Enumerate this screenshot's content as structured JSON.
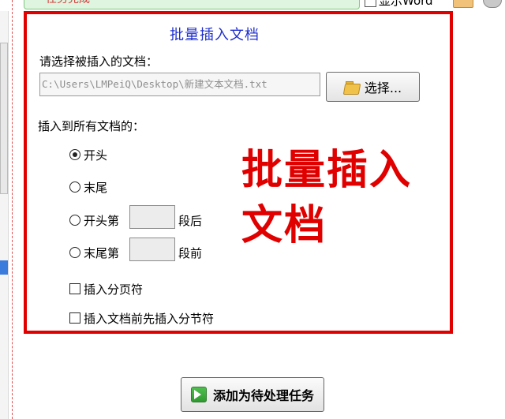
{
  "top": {
    "task_status_text": "任务完成",
    "show_word_label": "显示Word"
  },
  "panel": {
    "title": "批量插入文档",
    "select_label": "请选择被插入的文档：",
    "path_value": "C:\\Users\\LMPeiQ\\Desktop\\新建文本文档.txt",
    "choose_button": "选择...",
    "insert_to_label": "插入到所有文档的：",
    "options": {
      "start": "开头",
      "end": "末尾",
      "start_nth_prefix": "开头第",
      "start_nth_suffix": "段后",
      "end_nth_prefix": "末尾第",
      "end_nth_suffix": "段前"
    },
    "selected_option": "start",
    "checkboxes": {
      "page_break": "插入分页符",
      "section_break": "插入文档前先插入分节符"
    }
  },
  "annotation": {
    "line1": "批量插入",
    "line2": "文档",
    "color": "#e00000"
  },
  "footer": {
    "add_task_button": "添加为待处理任务"
  },
  "colors": {
    "title_blue": "#1f2fcc",
    "frame_red": "#e00000",
    "scroll_blue": "#3b7bdc"
  }
}
